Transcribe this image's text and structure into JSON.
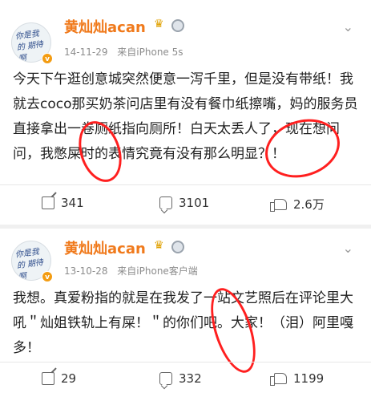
{
  "posts": [
    {
      "author": "黄灿灿acan",
      "avatar_text": "你是我的\n期待啊",
      "verified_badge": "v",
      "date": "14-11-29",
      "source": "来自iPhone 5s",
      "content": "今天下午逛创意城突然便意一泻千里，但是没有带纸！我就去coco那买奶茶问店里有没有餐巾纸擦嘴，妈的服务员直接拿出一卷厕纸指向厕所！白天太丢人了，现在想问问，我憋屎时的表情究竟有没有那么明显？！",
      "actions": {
        "repost": "341",
        "comment": "3101",
        "like": "2.6万"
      }
    },
    {
      "author": "黄灿灿acan",
      "avatar_text": "你是我的\n期待啊",
      "verified_badge": "v",
      "date": "13-10-28",
      "source": "来自iPhone客户端",
      "content": "我想。真爱粉指的就是在我发了一站文艺照后在评论里大吼＂灿姐铁轨上有屎！＂的你们吧。大家！（泪）阿里嘎多！",
      "actions": {
        "repost": "29",
        "comment": "332",
        "like": "1199"
      }
    }
  ],
  "icons": {
    "more": "chevron-down-icon",
    "crown": "crown-icon",
    "medal": "medal-icon",
    "repost": "repost-icon",
    "comment": "comment-icon",
    "like": "like-icon"
  },
  "colors": {
    "name": "#f07a1c",
    "annotation": "#ff1f1f"
  }
}
